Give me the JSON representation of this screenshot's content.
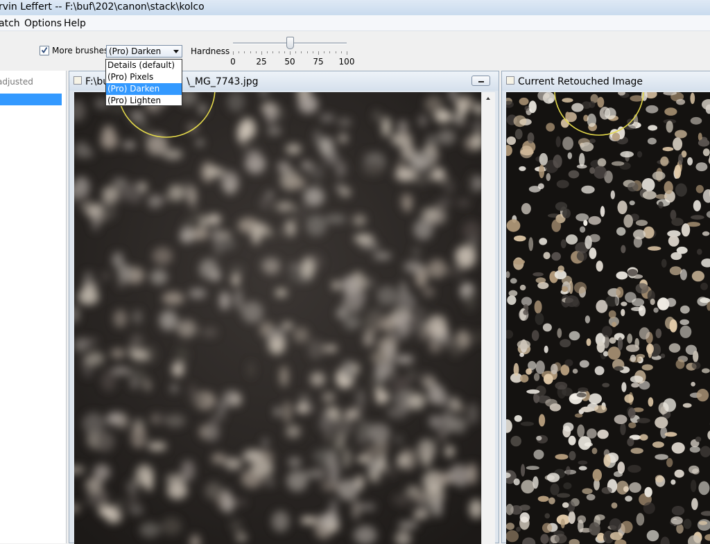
{
  "window": {
    "title": "rvin Leffert -- F:\\buf\\202\\canon\\stack\\kolco"
  },
  "menu": {
    "items": [
      "atch",
      "Options",
      "Help"
    ]
  },
  "toolbar": {
    "more_brushes": {
      "label": "More brushes",
      "checked": true
    },
    "brush_select": {
      "value": "(Pro) Darken",
      "options": [
        "Details (default)",
        "(Pro) Pixels",
        "(Pro) Darken",
        "(Pro) Lighten"
      ],
      "selected_index": 2
    },
    "hardness": {
      "label": "Hardness",
      "value": 50,
      "min": 0,
      "max": 100,
      "tick_labels": [
        "0",
        "25",
        "50",
        "75",
        "100"
      ]
    }
  },
  "left_panel": {
    "header": "adjusted"
  },
  "source_frame": {
    "title": "F:\\bu",
    "title_tail": "\\_MG_7743.jpg"
  },
  "retouched_frame": {
    "title": "Current Retouched Image"
  },
  "colors": {
    "selection": "#3399ff",
    "brush_circle": "#e3d84a"
  },
  "icons": {
    "checkbox": "check-icon",
    "dropdown": "chevron-down-icon",
    "frame": "image-frame-icon",
    "minimize": "minimize-icon",
    "scroll_up": "arrow-up-icon"
  }
}
